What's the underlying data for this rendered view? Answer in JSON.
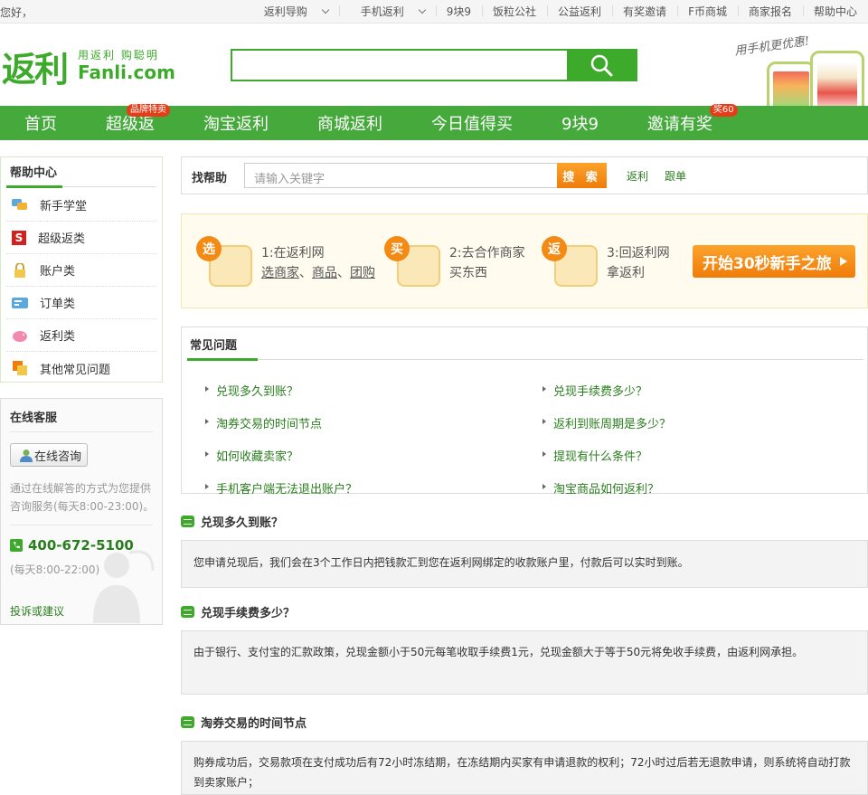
{
  "topbar": {
    "greeting": "您好，",
    "links": [
      "返利导购",
      "手机返利",
      "9块9",
      "饭粒公社",
      "公益返利",
      "有奖邀请",
      "F币商城",
      "商家报名",
      "帮助中心"
    ]
  },
  "logo": {
    "cn": "返利",
    "slogan": "用返利 购聪明",
    "en": "Fanli.com"
  },
  "header_ad": {
    "tagline": "用手机更优惠!"
  },
  "nav": {
    "items": [
      "首页",
      "超级返",
      "淘宝返利",
      "商城返利",
      "今日值得买",
      "9块9",
      "邀请有奖"
    ],
    "badge_super": "品牌特卖",
    "badge_invite": "奖60"
  },
  "sidebar": {
    "title": "帮助中心",
    "items": [
      "新手学堂",
      "超级返类",
      "账户类",
      "订单类",
      "返利类",
      "其他常见问题"
    ]
  },
  "service": {
    "title": "在线客服",
    "consult_label": "在线咨询",
    "desc": "通过在线解答的方式为您提供咨询服务(每天8:00-23:00)。",
    "phone": "400-672-5100",
    "hours": "(每天8:00-22:00)",
    "feedback": "投诉或建议"
  },
  "findhelp": {
    "label": "找帮助",
    "placeholder": "请输入关键字",
    "button": "搜 索",
    "link1": "返利",
    "link2": "跟单"
  },
  "steps": {
    "s1": {
      "badge": "选",
      "t1": "1:在返利网",
      "t2a": "选商家",
      "t2b": "商品",
      "t2c": "团购"
    },
    "s2": {
      "badge": "买",
      "t1": "2:去合作商家",
      "t2": "买东西"
    },
    "s3": {
      "badge": "返",
      "t1": "3:回返利网",
      "t2": "拿返利"
    },
    "start": "开始30秒新手之旅"
  },
  "faq": {
    "title": "常见问题",
    "left": [
      "兑现多久到账？",
      "淘券交易的时间节点",
      "如何收藏卖家？",
      "手机客户端无法退出账户？"
    ],
    "right": [
      "兑现手续费多少？",
      "返利到账周期是多少？",
      "提现有什么条件？",
      "淘宝商品如何返利？"
    ]
  },
  "qa": [
    {
      "q": "兑现多久到账？",
      "a": "您申请兑现后，我们会在3个工作日内把钱款汇到您在返利网绑定的收款账户里，付款后可以实时到账。"
    },
    {
      "q": "兑现手续费多少？",
      "a": "由于银行、支付宝的汇款政策，兑现金额小于50元每笔收取手续费1元，兑现金额大于等于50元将免收手续费，由返利网承担。"
    },
    {
      "q": "淘券交易的时间节点",
      "a": "购券成功后，交易款项在支付成功后有72小时冻结期，在冻结期内买家有申请退款的权利；72小时过后若无退款申请，则系统将自动打款到卖家账户；"
    }
  ],
  "colors": {
    "brand_green": "#45a93b",
    "link_green": "#2a7d1e",
    "orange": "#f07c0a",
    "badge_red": "#e63c17"
  }
}
